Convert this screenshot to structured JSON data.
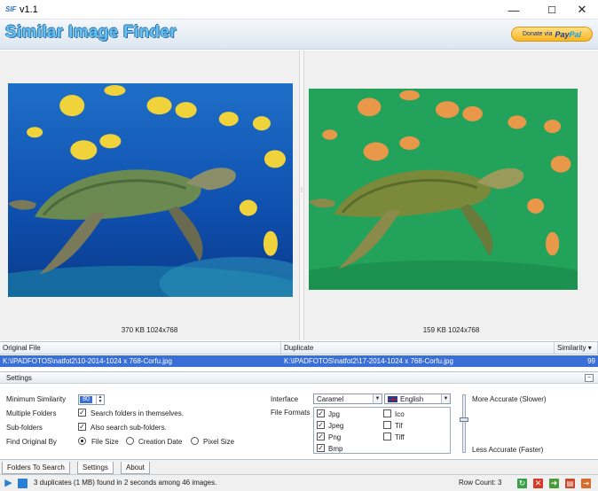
{
  "window": {
    "logo": "SIF",
    "title": "v1.1",
    "minimize": "—",
    "maximize": "☐",
    "close": "✕"
  },
  "header": {
    "app_name": "Similar Image Finder",
    "donate_prefix": "Donate via",
    "donate_pay": "Pay",
    "donate_pal": "Pal"
  },
  "preview": {
    "original_caption": "370 KB 1024x768",
    "duplicate_caption": "159 KB 1024x768",
    "divider_grip": "⁞"
  },
  "grid": {
    "columns": [
      "Original File",
      "Duplicate",
      "Similarity"
    ],
    "sort_arrow": "▾",
    "rows": [
      {
        "original": "K:\\IPADFOTOS\\natfot2\\10-2014-1024 x 768-Corfu.jpg",
        "duplicate": "K:\\IPADFOTOS\\natfot2\\17-2014-1024 x 768-Corfu.jpg",
        "similarity": "99"
      }
    ]
  },
  "settings": {
    "title": "Settings",
    "collapse": "−",
    "min_similarity_label": "Minimum Similarity",
    "min_similarity_value": "80",
    "multiple_folders_label": "Multiple Folders",
    "multiple_folders_option": "Search folders in themselves.",
    "subfolders_label": "Sub-folders",
    "subfolders_option": "Also search sub-folders.",
    "find_original_label": "Find Original By",
    "find_original_options": [
      "File Size",
      "Creation Date",
      "Pixel Size"
    ],
    "find_original_selected": "File Size",
    "interface_label": "Interface",
    "interface_value": "Caramel",
    "language_value": "English",
    "file_formats_label": "File Formats",
    "formats": [
      {
        "name": "Jpg",
        "checked": true
      },
      {
        "name": "Jpeg",
        "checked": true
      },
      {
        "name": "Png",
        "checked": true
      },
      {
        "name": "Bmp",
        "checked": true
      },
      {
        "name": "Ico",
        "checked": false
      },
      {
        "name": "Tif",
        "checked": false
      },
      {
        "name": "Tiff",
        "checked": false
      }
    ],
    "accuracy_high": "More Accurate (Slower)",
    "accuracy_low": "Less Accurate (Faster)"
  },
  "tabs": [
    "Folders To Search",
    "Settings",
    "About"
  ],
  "status": {
    "message": "3 duplicates (1 MB) found in 2 seconds among 46 images.",
    "row_count": "Row Count: 3"
  },
  "icons": [
    "play-icon",
    "stop-icon",
    "refresh-icon",
    "delete-icon",
    "move-icon",
    "export-icon",
    "exit-icon"
  ],
  "colors": {
    "selection": "#3a6fd8",
    "logo": "#66c1f0"
  }
}
